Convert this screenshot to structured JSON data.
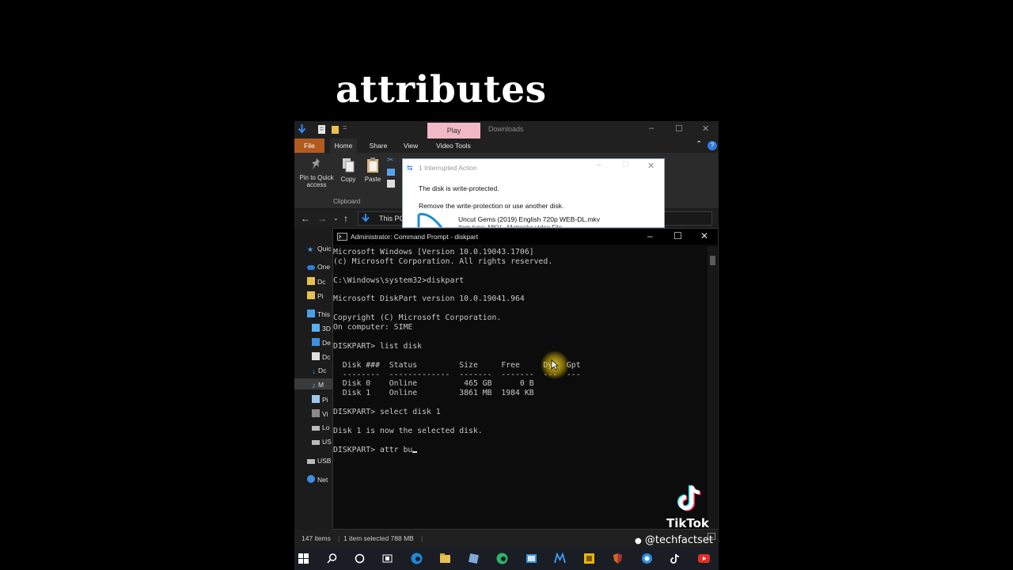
{
  "caption": "attributes",
  "explorer": {
    "context_tab": "Play",
    "title": "Downloads",
    "ribbon_tabs": [
      "File",
      "Home",
      "Share",
      "View",
      "Video Tools"
    ],
    "ribbon": {
      "pin_label": "Pin to Quick access",
      "copy_label": "Copy",
      "paste_label": "Paste",
      "group_label": "Clipboard"
    },
    "address": "This PC",
    "nav_items": [
      "Quic",
      "One",
      "Dc",
      "Pi",
      "This",
      "3D",
      "De",
      "Dc",
      "Dc",
      "M",
      "Pi",
      "Vi",
      "Lo",
      "US",
      "USB",
      "Net"
    ],
    "status": {
      "items": "147 items",
      "selected": "1 item selected  788 MB"
    }
  },
  "dialog": {
    "title": "1 Interrupted Action",
    "message": "The disk is write-protected.",
    "instruction": "Remove the write-protection or use another disk.",
    "file_name": "Uncut Gems (2019) English 720p WEB-DL.mkv",
    "file_type": "Item type: MKV - Matroska video File"
  },
  "cmd": {
    "title": "Administrator: Command Prompt - diskpart",
    "lines": [
      "Microsoft Windows [Version 10.0.19043.1706]",
      "(c) Microsoft Corporation. All rights reserved.",
      "",
      "C:\\Windows\\system32>diskpart",
      "",
      "Microsoft DiskPart version 10.0.19041.964",
      "",
      "Copyright (C) Microsoft Corporation.",
      "On computer: SIME",
      "",
      "DISKPART> list disk",
      "",
      "  Disk ###  Status         Size     Free     Dyn  Gpt",
      "  --------  -------------  -------  -------  ---  ---",
      "  Disk 0    Online          465 GB      0 B",
      "  Disk 1    Online         3861 MB  1984 KB",
      "",
      "DISKPART> select disk 1",
      "",
      "Disk 1 is now the selected disk.",
      "",
      "DISKPART> attr bu"
    ]
  },
  "watermark": {
    "brand": "TikTok",
    "handle": "@techfactset"
  }
}
